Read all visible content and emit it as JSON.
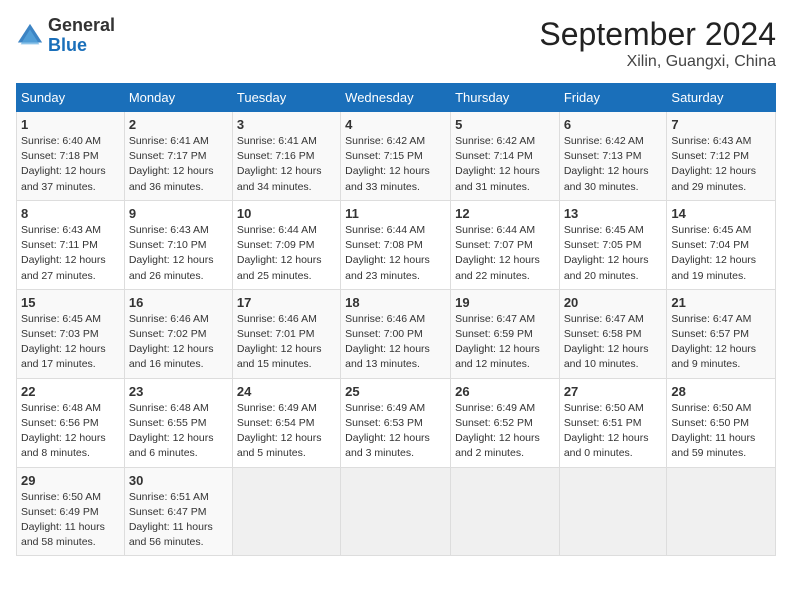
{
  "header": {
    "logo_general": "General",
    "logo_blue": "Blue",
    "month_title": "September 2024",
    "location": "Xilin, Guangxi, China"
  },
  "calendar": {
    "days_of_week": [
      "Sunday",
      "Monday",
      "Tuesday",
      "Wednesday",
      "Thursday",
      "Friday",
      "Saturday"
    ],
    "weeks": [
      [
        {
          "day": "1",
          "info": "Sunrise: 6:40 AM\nSunset: 7:18 PM\nDaylight: 12 hours\nand 37 minutes."
        },
        {
          "day": "2",
          "info": "Sunrise: 6:41 AM\nSunset: 7:17 PM\nDaylight: 12 hours\nand 36 minutes."
        },
        {
          "day": "3",
          "info": "Sunrise: 6:41 AM\nSunset: 7:16 PM\nDaylight: 12 hours\nand 34 minutes."
        },
        {
          "day": "4",
          "info": "Sunrise: 6:42 AM\nSunset: 7:15 PM\nDaylight: 12 hours\nand 33 minutes."
        },
        {
          "day": "5",
          "info": "Sunrise: 6:42 AM\nSunset: 7:14 PM\nDaylight: 12 hours\nand 31 minutes."
        },
        {
          "day": "6",
          "info": "Sunrise: 6:42 AM\nSunset: 7:13 PM\nDaylight: 12 hours\nand 30 minutes."
        },
        {
          "day": "7",
          "info": "Sunrise: 6:43 AM\nSunset: 7:12 PM\nDaylight: 12 hours\nand 29 minutes."
        }
      ],
      [
        {
          "day": "8",
          "info": "Sunrise: 6:43 AM\nSunset: 7:11 PM\nDaylight: 12 hours\nand 27 minutes."
        },
        {
          "day": "9",
          "info": "Sunrise: 6:43 AM\nSunset: 7:10 PM\nDaylight: 12 hours\nand 26 minutes."
        },
        {
          "day": "10",
          "info": "Sunrise: 6:44 AM\nSunset: 7:09 PM\nDaylight: 12 hours\nand 25 minutes."
        },
        {
          "day": "11",
          "info": "Sunrise: 6:44 AM\nSunset: 7:08 PM\nDaylight: 12 hours\nand 23 minutes."
        },
        {
          "day": "12",
          "info": "Sunrise: 6:44 AM\nSunset: 7:07 PM\nDaylight: 12 hours\nand 22 minutes."
        },
        {
          "day": "13",
          "info": "Sunrise: 6:45 AM\nSunset: 7:05 PM\nDaylight: 12 hours\nand 20 minutes."
        },
        {
          "day": "14",
          "info": "Sunrise: 6:45 AM\nSunset: 7:04 PM\nDaylight: 12 hours\nand 19 minutes."
        }
      ],
      [
        {
          "day": "15",
          "info": "Sunrise: 6:45 AM\nSunset: 7:03 PM\nDaylight: 12 hours\nand 17 minutes."
        },
        {
          "day": "16",
          "info": "Sunrise: 6:46 AM\nSunset: 7:02 PM\nDaylight: 12 hours\nand 16 minutes."
        },
        {
          "day": "17",
          "info": "Sunrise: 6:46 AM\nSunset: 7:01 PM\nDaylight: 12 hours\nand 15 minutes."
        },
        {
          "day": "18",
          "info": "Sunrise: 6:46 AM\nSunset: 7:00 PM\nDaylight: 12 hours\nand 13 minutes."
        },
        {
          "day": "19",
          "info": "Sunrise: 6:47 AM\nSunset: 6:59 PM\nDaylight: 12 hours\nand 12 minutes."
        },
        {
          "day": "20",
          "info": "Sunrise: 6:47 AM\nSunset: 6:58 PM\nDaylight: 12 hours\nand 10 minutes."
        },
        {
          "day": "21",
          "info": "Sunrise: 6:47 AM\nSunset: 6:57 PM\nDaylight: 12 hours\nand 9 minutes."
        }
      ],
      [
        {
          "day": "22",
          "info": "Sunrise: 6:48 AM\nSunset: 6:56 PM\nDaylight: 12 hours\nand 8 minutes."
        },
        {
          "day": "23",
          "info": "Sunrise: 6:48 AM\nSunset: 6:55 PM\nDaylight: 12 hours\nand 6 minutes."
        },
        {
          "day": "24",
          "info": "Sunrise: 6:49 AM\nSunset: 6:54 PM\nDaylight: 12 hours\nand 5 minutes."
        },
        {
          "day": "25",
          "info": "Sunrise: 6:49 AM\nSunset: 6:53 PM\nDaylight: 12 hours\nand 3 minutes."
        },
        {
          "day": "26",
          "info": "Sunrise: 6:49 AM\nSunset: 6:52 PM\nDaylight: 12 hours\nand 2 minutes."
        },
        {
          "day": "27",
          "info": "Sunrise: 6:50 AM\nSunset: 6:51 PM\nDaylight: 12 hours\nand 0 minutes."
        },
        {
          "day": "28",
          "info": "Sunrise: 6:50 AM\nSunset: 6:50 PM\nDaylight: 11 hours\nand 59 minutes."
        }
      ],
      [
        {
          "day": "29",
          "info": "Sunrise: 6:50 AM\nSunset: 6:49 PM\nDaylight: 11 hours\nand 58 minutes."
        },
        {
          "day": "30",
          "info": "Sunrise: 6:51 AM\nSunset: 6:47 PM\nDaylight: 11 hours\nand 56 minutes."
        },
        {
          "day": "",
          "info": ""
        },
        {
          "day": "",
          "info": ""
        },
        {
          "day": "",
          "info": ""
        },
        {
          "day": "",
          "info": ""
        },
        {
          "day": "",
          "info": ""
        }
      ]
    ]
  }
}
